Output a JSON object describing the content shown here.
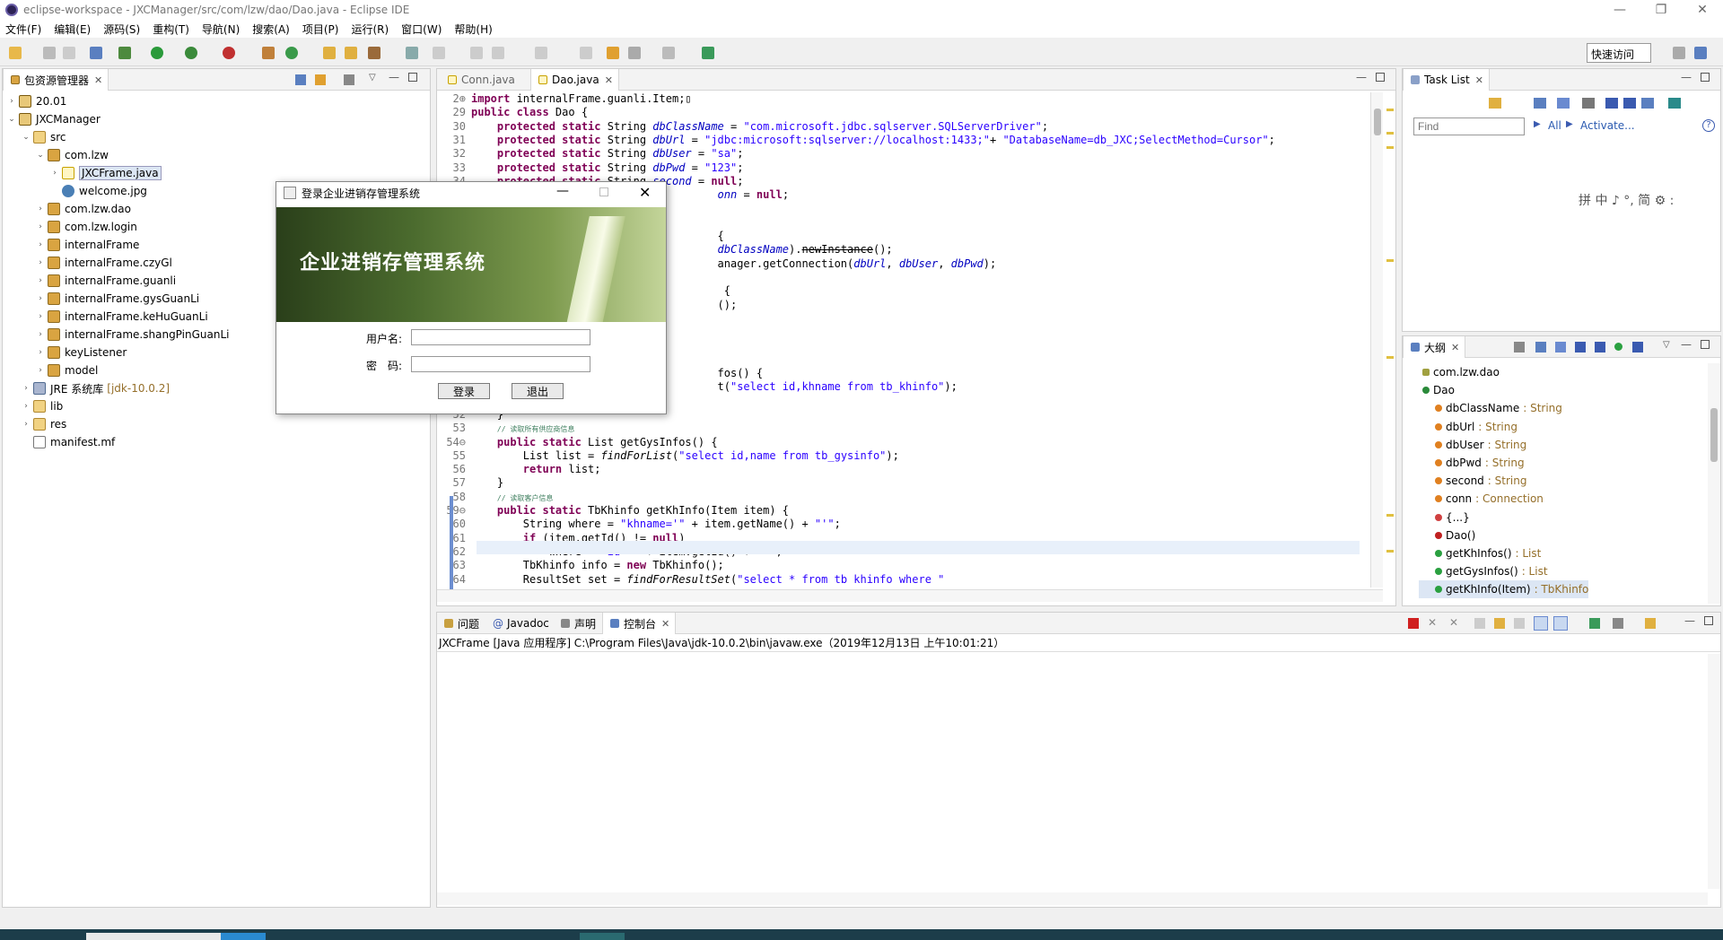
{
  "window": {
    "title": "eclipse-workspace - JXCManager/src/com/lzw/dao/Dao.java - Eclipse IDE",
    "min": "—",
    "max": "❐",
    "close": "✕"
  },
  "menu": [
    "文件(F)",
    "编辑(E)",
    "源码(S)",
    "重构(T)",
    "导航(N)",
    "搜索(A)",
    "项目(P)",
    "运行(R)",
    "窗口(W)",
    "帮助(H)"
  ],
  "quick_access": "快速访问",
  "package_explorer": {
    "tab": "包资源管理器",
    "items": [
      {
        "label": "20.01",
        "indent": 0,
        "tw": "›",
        "icon": "proj"
      },
      {
        "label": "JXCManager",
        "indent": 0,
        "tw": "⌄",
        "icon": "proj"
      },
      {
        "label": "src",
        "indent": 1,
        "tw": "⌄",
        "icon": "folder"
      },
      {
        "label": "com.lzw",
        "indent": 2,
        "tw": "⌄",
        "icon": "pkg"
      },
      {
        "label": "JXCFrame.java",
        "indent": 3,
        "tw": "›",
        "icon": "java"
      },
      {
        "label": "welcome.jpg",
        "indent": 3,
        "tw": "",
        "icon": "img"
      },
      {
        "label": "com.lzw.dao",
        "indent": 2,
        "tw": "›",
        "icon": "pkg"
      },
      {
        "label": "com.lzw.login",
        "indent": 2,
        "tw": "›",
        "icon": "pkg"
      },
      {
        "label": "internalFrame",
        "indent": 2,
        "tw": "›",
        "icon": "pkg"
      },
      {
        "label": "internalFrame.czyGl",
        "indent": 2,
        "tw": "›",
        "icon": "pkg"
      },
      {
        "label": "internalFrame.guanli",
        "indent": 2,
        "tw": "›",
        "icon": "pkg"
      },
      {
        "label": "internalFrame.gysGuanLi",
        "indent": 2,
        "tw": "›",
        "icon": "pkg"
      },
      {
        "label": "internalFrame.keHuGuanLi",
        "indent": 2,
        "tw": "›",
        "icon": "pkg"
      },
      {
        "label": "internalFrame.shangPinGuanLi",
        "indent": 2,
        "tw": "›",
        "icon": "pkg"
      },
      {
        "label": "keyListener",
        "indent": 2,
        "tw": "›",
        "icon": "pkg"
      },
      {
        "label": "model",
        "indent": 2,
        "tw": "›",
        "icon": "pkg"
      },
      {
        "label": "JRE 系统库",
        "suffix": "[jdk-10.0.2]",
        "indent": 1,
        "tw": "›",
        "icon": "lib"
      },
      {
        "label": "lib",
        "indent": 1,
        "tw": "›",
        "icon": "folder"
      },
      {
        "label": "res",
        "indent": 1,
        "tw": "›",
        "icon": "folder"
      },
      {
        "label": "manifest.mf",
        "indent": 1,
        "tw": "",
        "icon": "file"
      }
    ]
  },
  "editor": {
    "tabs": [
      "Conn.java",
      "Dao.java"
    ],
    "lines": [
      {
        "n": "2⊕",
        "html": "<span class='kw'>import</span> internalFrame.guanli.Item;▯"
      },
      {
        "n": "29",
        "html": "<span class='kw'>public class</span> Dao {"
      },
      {
        "n": "30",
        "html": "    <span class='kw'>protected static</span> String <span class='fld'>dbClassName</span> = <span class='str'>\"com.microsoft.jdbc.sqlserver.SQLServerDriver\"</span>;"
      },
      {
        "n": "31",
        "html": "    <span class='kw'>protected static</span> String <span class='fld'>dbUrl</span> = <span class='str'>\"jdbc:microsoft:sqlserver://localhost:1433;\"</span>+ <span class='str'>\"DatabaseName=db_JXC;SelectMethod=Cursor\"</span>;"
      },
      {
        "n": "32",
        "html": "    <span class='kw'>protected static</span> String <span class='fld'>dbUser</span> = <span class='str'>\"sa\"</span>;"
      },
      {
        "n": "33",
        "html": "    <span class='kw'>protected static</span> String <span class='fld'>dbPwd</span> = <span class='str'>\"123\"</span>;"
      },
      {
        "n": "34",
        "html": "    <span class='kw'>protected static</span> String <span class='fld'>second</span> = <span class='kw'>null</span>;"
      },
      {
        "n": "",
        "html": "                                      <span class='fld'>onn</span> = <span class='kw'>null</span>;"
      },
      {
        "n": "",
        "html": ""
      },
      {
        "n": "",
        "html": ""
      },
      {
        "n": "",
        "html": "                                      {"
      },
      {
        "n": "",
        "html": "                                      <span class='fld'>dbClassName</span>).<s>newInstance</s>();"
      },
      {
        "n": "",
        "html": "                                      anager.getConnection(<span class='fld'>dbUrl</span>, <span class='fld'>dbUser</span>, <span class='fld'>dbPwd</span>);"
      },
      {
        "n": "",
        "html": ""
      },
      {
        "n": "",
        "html": "                                       {"
      },
      {
        "n": "",
        "html": "                                      ();"
      },
      {
        "n": "",
        "html": ""
      },
      {
        "n": "",
        "html": ""
      },
      {
        "n": "",
        "html": ""
      },
      {
        "n": "",
        "html": ""
      },
      {
        "n": "",
        "html": "                                      fos() {"
      },
      {
        "n": "",
        "html": "                                      t(<span class='str'>\"select id,khname from tb_khinfo\"</span>);"
      },
      {
        "n": "",
        "html": ""
      },
      {
        "n": "52",
        "html": "    }"
      },
      {
        "n": "53",
        "html": "    <span class='cm'>// 读取所有供应商信息</span>"
      },
      {
        "n": "54⊖",
        "html": "    <span class='kw'>public static</span> List getGysInfos() {"
      },
      {
        "n": "55",
        "html": "        List list = <i>findForList</i>(<span class='str'>\"select id,name from tb_gysinfo\"</span>);"
      },
      {
        "n": "56",
        "html": "        <span class='kw'>return</span> list;"
      },
      {
        "n": "57",
        "html": "    }"
      },
      {
        "n": "58",
        "html": "    <span class='cm'>// 读取客户信息</span>"
      },
      {
        "n": "59⊖",
        "html": "    <span class='kw'>public static</span> TbKhinfo getKhInfo(Item item) {"
      },
      {
        "n": "60",
        "html": "        String where = <span class='str'>\"khname='\"</span> + item.getName() + <span class='str'>\"'\"</span>;"
      },
      {
        "n": "61",
        "html": "        <span class='kw'>if</span> (item.getId() != <span class='kw'>null</span>)"
      },
      {
        "n": "62",
        "html": "            where = <span class='str'>\"id='\"</span> + item.getId() + <span class='str'>\"'\"</span>;"
      },
      {
        "n": "63",
        "html": "        TbKhinfo info = <span class='kw'>new</span> TbKhinfo();"
      },
      {
        "n": "64",
        "html": "        ResultSet set = <i>findForResultSet</i>(<span class='str'>\"select * from tb khinfo where \"</span>"
      }
    ]
  },
  "tasklist": {
    "tab": "Task List",
    "find_placeholder": "Find",
    "all": "All",
    "activate": "Activate...",
    "ime": "拼 中 ♪ °, 简 ⚙ :"
  },
  "outline": {
    "tab": "大纲",
    "items": [
      {
        "label": "com.lzw.dao",
        "type": "",
        "level": 0,
        "icon": "pkg"
      },
      {
        "label": "Dao",
        "type": "",
        "level": 0,
        "icon": "class"
      },
      {
        "label": "dbClassName",
        "type": ": String",
        "level": 1,
        "icon": "fld"
      },
      {
        "label": "dbUrl",
        "type": ": String",
        "level": 1,
        "icon": "fld"
      },
      {
        "label": "dbUser",
        "type": ": String",
        "level": 1,
        "icon": "fld"
      },
      {
        "label": "dbPwd",
        "type": ": String",
        "level": 1,
        "icon": "fld"
      },
      {
        "label": "second",
        "type": ": String",
        "level": 1,
        "icon": "fld"
      },
      {
        "label": "conn",
        "type": ": Connection",
        "level": 1,
        "icon": "fld"
      },
      {
        "label": "{...}",
        "type": "",
        "level": 1,
        "icon": "init"
      },
      {
        "label": "Dao()",
        "type": "",
        "level": 1,
        "icon": "ctor"
      },
      {
        "label": "getKhInfos()",
        "type": ": List",
        "level": 1,
        "icon": "meth"
      },
      {
        "label": "getGysInfos()",
        "type": ": List",
        "level": 1,
        "icon": "meth"
      },
      {
        "label": "getKhInfo(Item)",
        "type": ": TbKhinfo",
        "level": 1,
        "icon": "meth"
      }
    ]
  },
  "console": {
    "tabs": [
      "问题",
      "Javadoc",
      "声明",
      "控制台"
    ],
    "status": "JXCFrame [Java 应用程序] C:\\Program Files\\Java\\jdk-10.0.2\\bin\\javaw.exe（2019年12月13日 上午10:01:21）"
  },
  "dialog": {
    "title": "登录企业进销存管理系统",
    "banner": "企业进销存管理系统",
    "user_label": "用户名:",
    "pwd_label": "密　码:",
    "login": "登录",
    "exit": "退出"
  }
}
